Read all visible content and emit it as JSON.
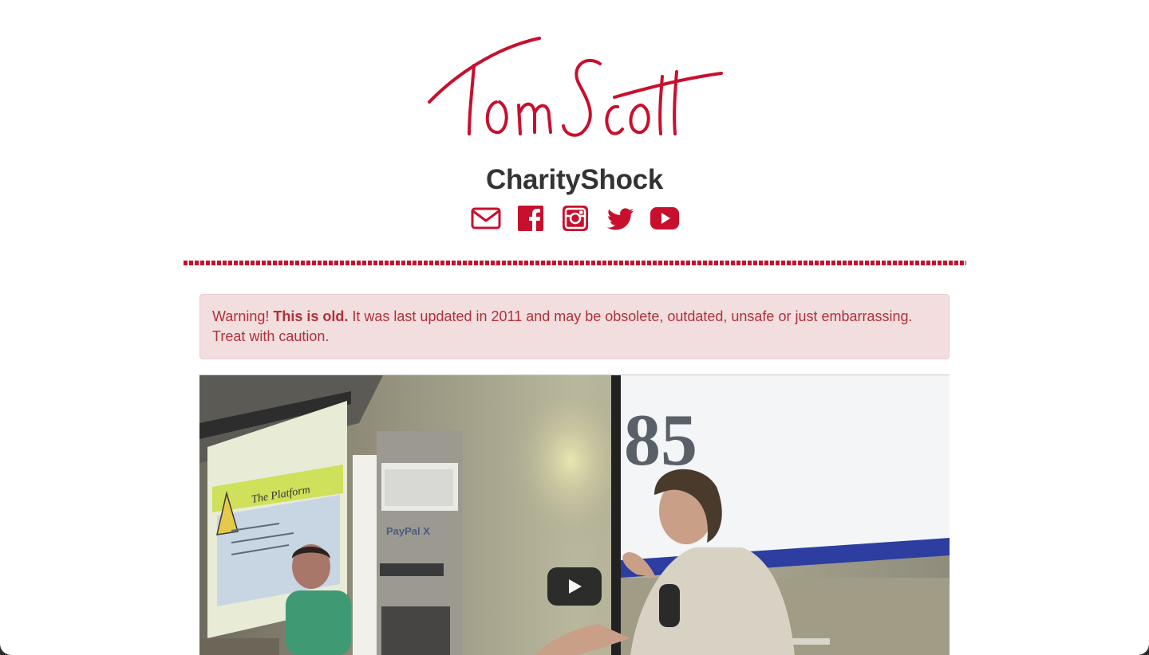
{
  "header": {
    "logo_text": "Tom Scott",
    "title": "CharityShock"
  },
  "social_links": [
    {
      "name": "email",
      "icon": "envelope-icon"
    },
    {
      "name": "facebook",
      "icon": "facebook-icon"
    },
    {
      "name": "instagram",
      "icon": "instagram-icon"
    },
    {
      "name": "twitter",
      "icon": "twitter-icon"
    },
    {
      "name": "youtube",
      "icon": "youtube-icon"
    }
  ],
  "alert": {
    "prefix": "Warning!",
    "emphasis": "This is old.",
    "message": "It was last updated in 2011 and may be obsolete, outdated, unsafe or just embarrassing. Treat with caution."
  },
  "video": {
    "slide_number": "85",
    "slide_title": "The Platform",
    "banner_text": "PayPal X"
  },
  "colors": {
    "accent": "#c8102e",
    "alert_bg": "#f2dede",
    "alert_text": "#b0303a",
    "title_text": "#333333"
  }
}
